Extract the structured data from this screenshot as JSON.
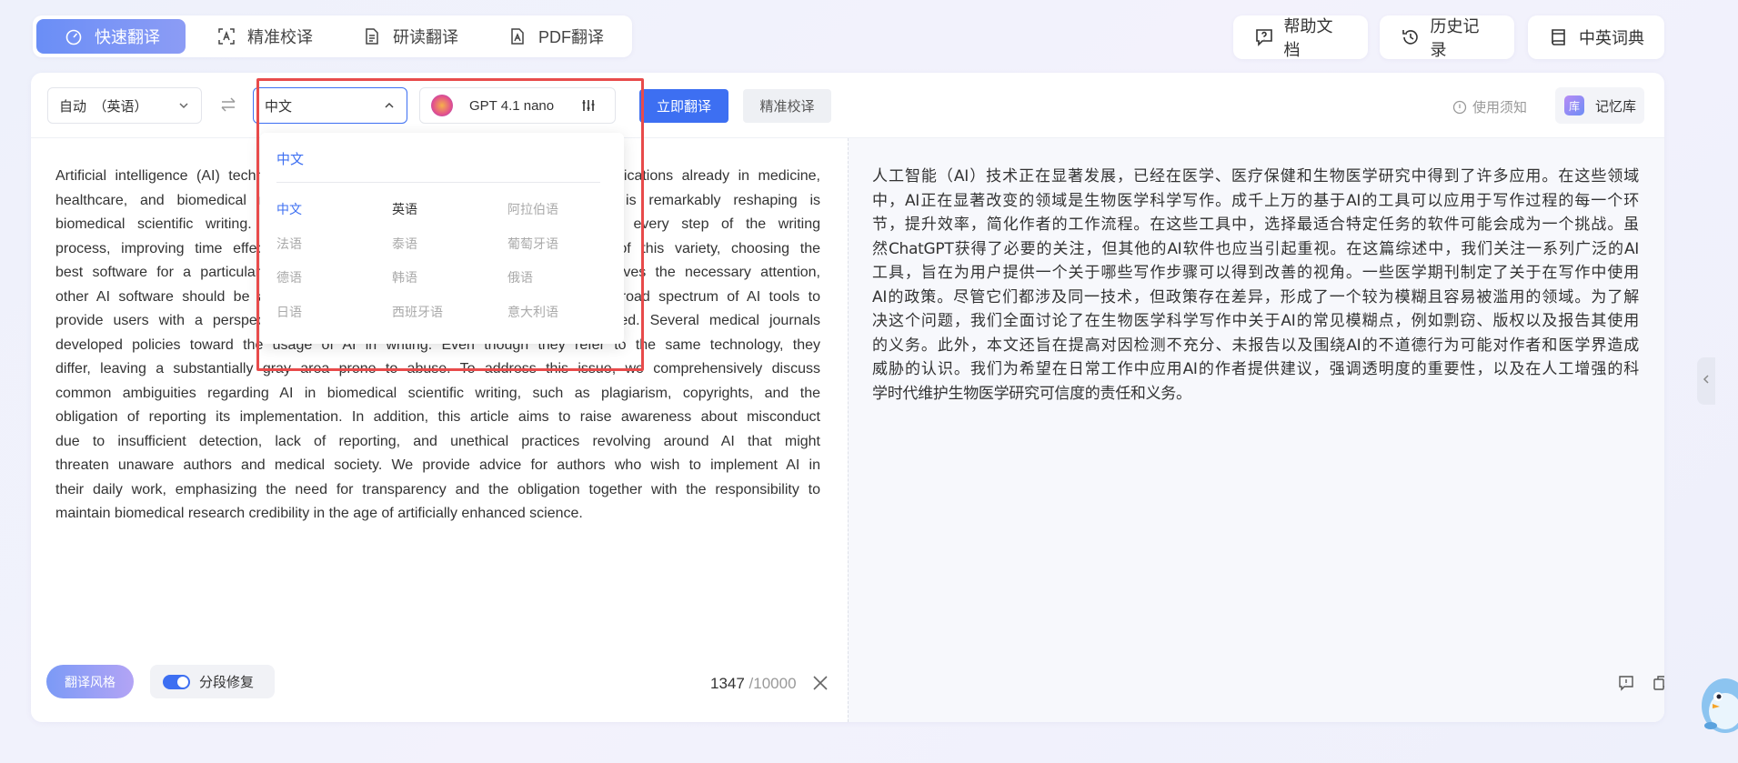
{
  "mode_tabs": [
    {
      "label": "快速翻译",
      "icon": "speedometer-icon"
    },
    {
      "label": "精准校译",
      "icon": "text-scan-icon"
    },
    {
      "label": "研读翻译",
      "icon": "document-icon"
    },
    {
      "label": "PDF翻译",
      "icon": "pdf-icon"
    }
  ],
  "header_buttons": {
    "help": "帮助文档",
    "history": "历史记录",
    "dictionary": "中英词典"
  },
  "toolbar": {
    "source_lang": "自动　（英语）",
    "target_lang": "中文",
    "model": "GPT 4.1 nano",
    "translate": "立即翻译",
    "proofread": "精准校译",
    "notice": "使用须知",
    "memory": "记忆库",
    "memory_badge": "库"
  },
  "dropdown": {
    "current": "中文",
    "languages": [
      [
        "中文",
        "英语",
        "阿拉伯语"
      ],
      [
        "法语",
        "泰语",
        "葡萄牙语"
      ],
      [
        "德语",
        "韩语",
        "俄语"
      ],
      [
        "日语",
        "西班牙语",
        "意大利语"
      ]
    ]
  },
  "source": {
    "lines": [
      "Artificial intelligence (AI) technology is advancing significantly, with numerous applications already in medicine,",
      "healthcare, and biomedical research. Among these fields, the area that AI is remarkably reshaping is",
      "biomedical scientific writing. Thousands of AI-based tools can be applied at every step of the writing",
      "process, improving time effectiveness and streamlining authors' workflow. Out of this variety, choosing the",
      "best software for a particular task may pose a challenge. While ChatGPT receives the necessary attention,",
      "other AI software should be addressed. In this review, we draw attention to a broad spectrum of AI tools to",
      "provide users with a perspective on which steps of their work can be improved. Several medical journals",
      "developed policies toward the usage of AI in writing. Even though they refer to the same technology, they",
      "differ, leaving a substantially gray area prone to abuse. To address this issue, we comprehensively discuss",
      "common ambiguities regarding AI in biomedical scientific writing, such as plagiarism, copyrights, and the",
      "obligation of reporting its implementation. In addition, this article aims to raise awareness about misconduct",
      "due to insufficient detection, lack of reporting, and unethical practices revolving around AI that might",
      "threaten unaware authors and medical society. We provide advice for authors who wish to implement AI in",
      "their daily work, emphasizing the need for transparency and the obligation together with the responsibility to",
      "maintain biomedical research credibility in the age of artificially enhanced science."
    ],
    "count": "1347",
    "max": " /10000"
  },
  "target": {
    "lines": [
      "人工智能（AI）技术正在显著发展，已经在医学、医疗保健和生物医学研究中得到了许多应用。在这些领域",
      "中，AI正在显著改变的领域是生物医学科学写作。成千上万的基于AI的工具可以应用于写作过程的每一个环",
      "节，提升效率，简化作者的工作流程。在这些工具中，选择最适合特定任务的软件可能会成为一个挑战。虽",
      "然ChatGPT获得了必要的关注，但其他的AI软件也应当引起重视。在这篇综述中，我们关注一系列广泛的AI",
      "工具，旨在为用户提供一个关于哪些写作步骤可以得到改善的视角。一些医学期刊制定了关于在写作中使用",
      "AI的政策。尽管它们都涉及同一技术，但政策存在差异，形成了一个较为模糊且容易被滥用的领域。为了解",
      "决这个问题，我们全面讨论了在生物医学科学写作中关于AI的常见模糊点，例如剽窃、版权以及报告其使用",
      "的义务。此外，本文还旨在提高对因检测不充分、未报告以及围绕AI的不道德行为可能对作者和医学界造成",
      "威胁的认识。我们为希望在日常工作中应用AI的作者提供建议，强调透明度的重要性，以及在人工增强的科",
      "学时代维护生物医学研究可信度的责任和义务。"
    ]
  },
  "bottom": {
    "style": "翻译风格",
    "segment_fix": "分段修复"
  },
  "colors": {
    "accent": "#3d6ff2",
    "highlight": "#e84b4b"
  }
}
